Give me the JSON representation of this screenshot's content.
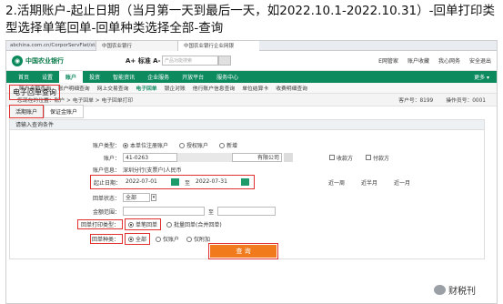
{
  "caption": "2.活期账户-起止日期（当月第一天到最后一天，如2022.10.1-2022.10.31）-回单打印类型选择单笔回单-回单种类选择全部-查询",
  "browser": {
    "url": "abchina.com.cn/CorporServFlat/start ⊘",
    "tab1": "中国农业银行",
    "tab2": "中国农业银行企业网银"
  },
  "header": {
    "bank_name": "中国农业银行",
    "font_size": "A+ 标准 A-",
    "search_placeholder": "产品功能搜索",
    "links": [
      "E网管家",
      "账户收藏",
      "我心网务",
      "安全退出"
    ]
  },
  "nav": {
    "items": [
      "首页",
      "设置",
      "账户",
      "投资",
      "智能资讯",
      "企业服务",
      "开放平台",
      "服务中心"
    ],
    "active_index": 2,
    "more": "更多 ▾"
  },
  "subnav": {
    "items": [
      "账户余额查询",
      "账户明细查询",
      "网上交易查询",
      "电子回单",
      "银企对账",
      "他行账户信息查询",
      "单位结算卡",
      "收费明细查询"
    ],
    "active_index": 3
  },
  "location": {
    "text": "您现在的位置：账户 > 电子回单 > 电子回单打印",
    "customer_no": "客户号：8199",
    "operator_no": "操作员号：0001"
  },
  "page_title": "电子回单查询",
  "tabs": [
    "活期账户",
    "保证金账户"
  ],
  "panel_title": "请输入查询条件",
  "form": {
    "account_type_label": "账户类型：",
    "account_type_options": [
      "本单位注册账户",
      "授权账户",
      "新增"
    ],
    "account_label": "账户：",
    "account_value": "41-0263",
    "account_name_tail": "有限公司",
    "receive_label": "收款方",
    "pay_label": "付款方",
    "account_info_label": "账户信息：",
    "account_info_value": "深圳分行(支票户)人民币",
    "date_label": "起止日期：",
    "date_start": "2022-07-01",
    "date_to": "至",
    "date_end": "2022-07-31",
    "quick_ranges": [
      "近一周",
      "近半月",
      "近一月"
    ],
    "status_label": "回单状态：",
    "status_value": "全部",
    "amount_label": "金额范围：",
    "amount_to": "至",
    "print_type_label": "回单打印类型：",
    "print_type_options": [
      "单笔回单",
      "批量回单(合并回单)"
    ],
    "kind_label": "回单种类：",
    "kind_options": [
      "全部",
      "仅账户",
      "仅附加"
    ],
    "query_button": "查 询"
  },
  "watermark": "财税刊"
}
